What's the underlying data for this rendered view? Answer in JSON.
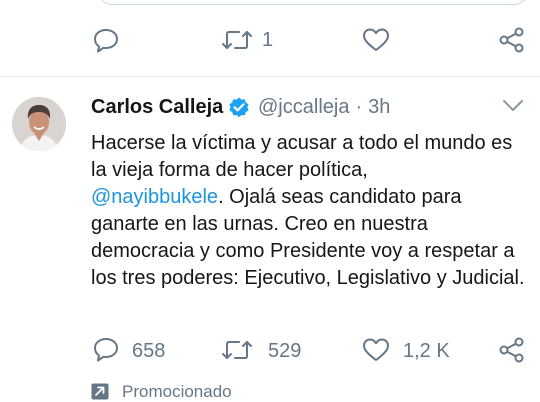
{
  "prev_tweet": {
    "retweet_count": "1"
  },
  "tweet": {
    "author_name": "Carlos Calleja",
    "handle": "@jccalleja",
    "separator": "·",
    "time": "3h",
    "text_before": "Hacerse la víctima y acusar a todo el mundo es la vieja forma de hacer política,",
    "mention": "@nayibbukele",
    "text_after": ". Ojalá seas candidato para ganarte en las urnas. Creo en nuestra democracia y como Presidente voy a respetar a los tres poderes: Ejecutivo, Legislativo y Judicial.",
    "reply_count": "658",
    "retweet_count": "529",
    "like_count": "1,2 K",
    "promoted_label": "Promocionado"
  },
  "icons": {
    "reply": "reply-icon",
    "retweet": "retweet-icon",
    "like": "heart-icon",
    "share": "share-icon",
    "verified": "verified-badge-icon",
    "caret": "chevron-down-icon",
    "promoted": "promoted-arrow-icon"
  },
  "colors": {
    "text": "#14171a",
    "secondary": "#657786",
    "link": "#1b95e0",
    "verified": "#1da1f2",
    "divider": "#e1e8ed"
  }
}
